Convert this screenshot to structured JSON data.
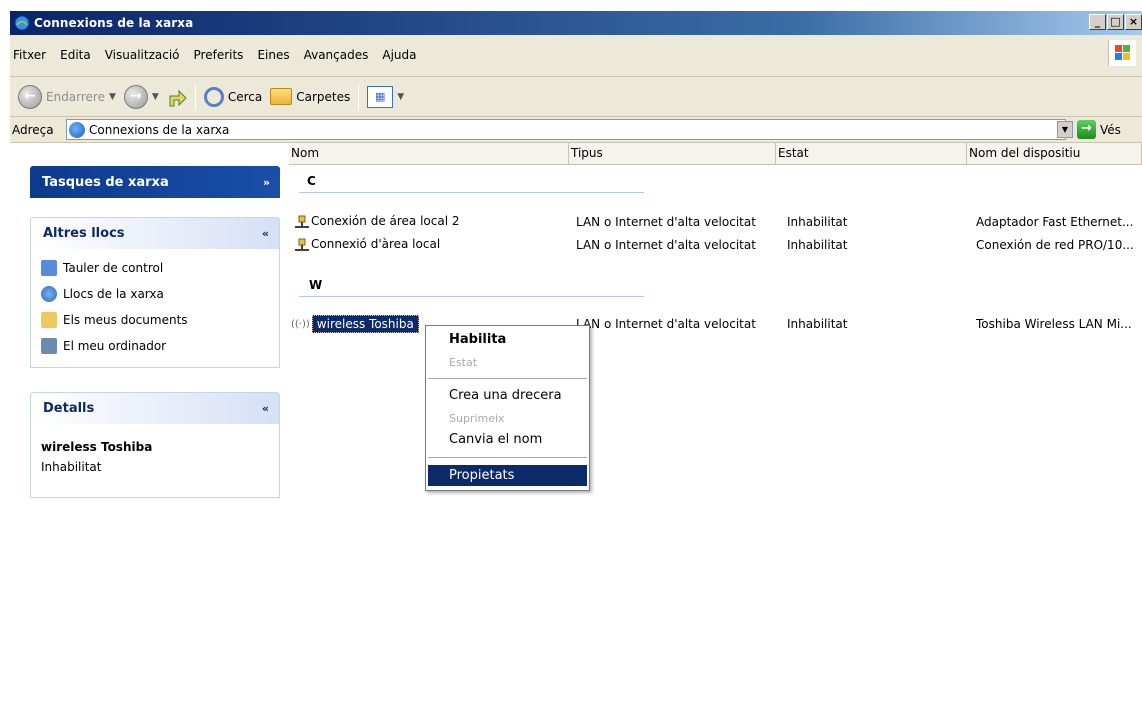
{
  "window": {
    "title": "Connexions de la xarxa",
    "controls": [
      "_",
      "□",
      "×"
    ]
  },
  "menu": [
    "Fitxer",
    "Edita",
    "Visualització",
    "Preferits",
    "Eines",
    "Avançades",
    "Ajuda"
  ],
  "toolbar": {
    "back_label": "Endarrere",
    "search_label": "Cerca",
    "folders_label": "Carpetes"
  },
  "address": {
    "label": "Adreça",
    "value": "Connexions de la xarxa",
    "go_label": "Vés"
  },
  "left": {
    "network_tasks": "Tasques de xarxa",
    "other_places": {
      "title": "Altres llocs",
      "items": [
        "Tauler de control",
        "Llocs de la xarxa",
        "Els meus documents",
        "El meu ordinador"
      ]
    },
    "details": {
      "title": "Detalls",
      "name": "wireless Toshiba",
      "status": "Inhabilitat"
    }
  },
  "columns": [
    "Nom",
    "Tipus",
    "Estat",
    "Nom del dispositiu"
  ],
  "groups": [
    {
      "letter": "C",
      "rows": [
        {
          "name": "Conexión de área local 2",
          "type": "LAN o Internet d'alta velocitat",
          "status": "Inhabilitat",
          "device": "Adaptador Fast Ethernet..."
        },
        {
          "name": "Connexió d'àrea local",
          "type": "LAN o Internet d'alta velocitat",
          "status": "Inhabilitat",
          "device": "Conexión de red PRO/10..."
        }
      ]
    },
    {
      "letter": "W",
      "rows": [
        {
          "name": "wireless Toshiba",
          "type": "LAN o Internet d'alta velocitat",
          "status": "Inhabilitat",
          "device": "Toshiba Wireless LAN Mi..."
        }
      ]
    }
  ],
  "context_menu": {
    "enable": "Habilita",
    "status": "Estat",
    "create_shortcut": "Crea una drecera",
    "delete": "Suprimeix",
    "rename": "Canvia el nom",
    "properties": "Propietats"
  }
}
